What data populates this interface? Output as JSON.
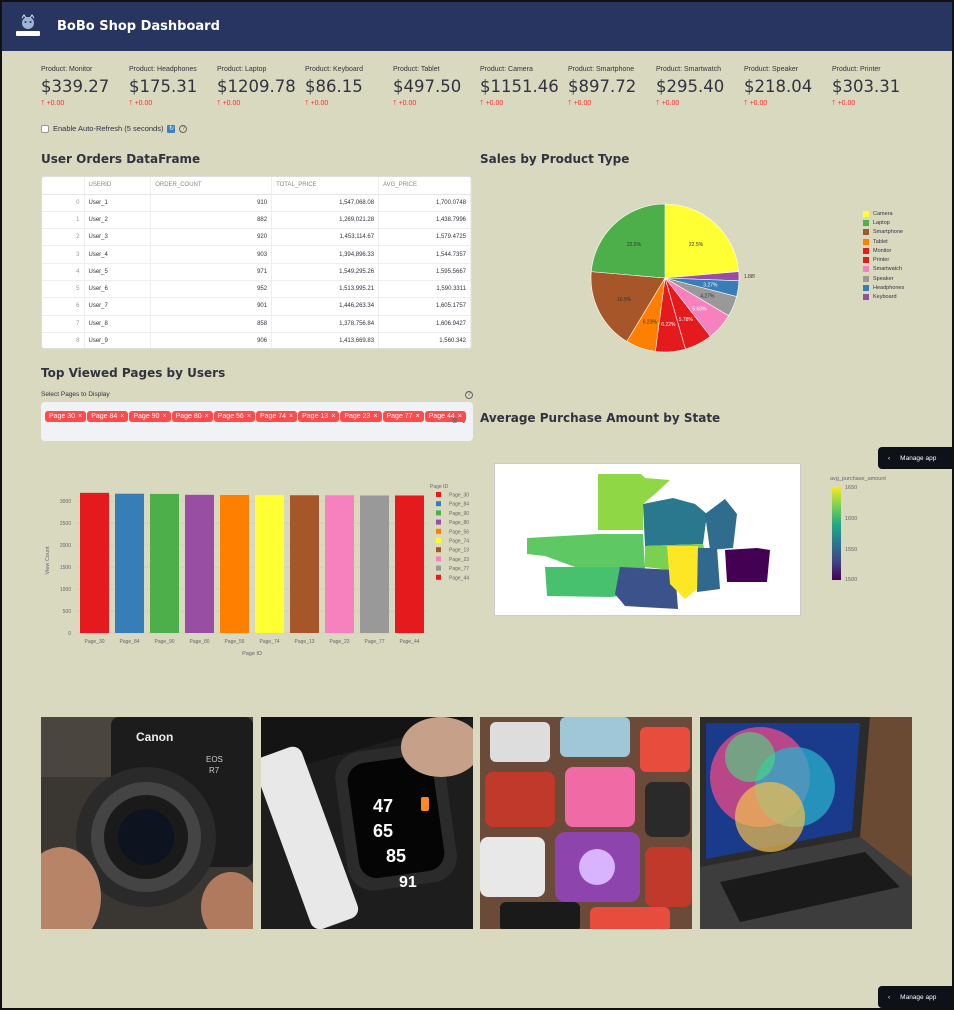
{
  "header": {
    "title": "BoBo Shop Dashboard",
    "logo_text": "BOBO SHOP"
  },
  "metrics": [
    {
      "label": "Product: Monitor",
      "value": "$339.27",
      "delta": "+0.00"
    },
    {
      "label": "Product: Headphones",
      "value": "$175.31",
      "delta": "+0.00"
    },
    {
      "label": "Product: Laptop",
      "value": "$1209.78",
      "delta": "+0.00"
    },
    {
      "label": "Product: Keyboard",
      "value": "$86.15",
      "delta": "+0.00"
    },
    {
      "label": "Product: Tablet",
      "value": "$497.50",
      "delta": "+0.00"
    },
    {
      "label": "Product: Camera",
      "value": "$1151.46",
      "delta": "+0.00"
    },
    {
      "label": "Product: Smartphone",
      "value": "$897.72",
      "delta": "+0.00"
    },
    {
      "label": "Product: Smartwatch",
      "value": "$295.40",
      "delta": "+0.00"
    },
    {
      "label": "Product: Speaker",
      "value": "$218.04",
      "delta": "+0.00"
    },
    {
      "label": "Product: Printer",
      "value": "$303.31",
      "delta": "+0.00"
    }
  ],
  "autorefresh": {
    "label": "Enable Auto-Refresh (5 seconds)",
    "checked": false
  },
  "orders": {
    "title": "User Orders DataFrame",
    "columns": [
      "",
      "USERID",
      "ORDER_COUNT",
      "TOTAL_PRICE",
      "AVG_PRICE"
    ],
    "rows": [
      [
        "0",
        "User_1",
        "910",
        "1,547,068.08",
        "1,700.0748"
      ],
      [
        "1",
        "User_2",
        "882",
        "1,269,021.28",
        "1,438.7996"
      ],
      [
        "2",
        "User_3",
        "920",
        "1,453,114.67",
        "1,579.4725"
      ],
      [
        "3",
        "User_4",
        "903",
        "1,394,896.33",
        "1,544.7357"
      ],
      [
        "4",
        "User_5",
        "971",
        "1,549,295.26",
        "1,595.5667"
      ],
      [
        "5",
        "User_6",
        "952",
        "1,513,995.21",
        "1,590.3311"
      ],
      [
        "6",
        "User_7",
        "901",
        "1,446,263.34",
        "1,605.1757"
      ],
      [
        "7",
        "User_8",
        "858",
        "1,378,756.84",
        "1,606.9427"
      ],
      [
        "8",
        "User_9",
        "906",
        "1,413,669.83",
        "1,560.342"
      ]
    ]
  },
  "pie": {
    "title": "Sales by Product Type",
    "legend": [
      {
        "name": "Camera",
        "color": "#ffff33"
      },
      {
        "name": "Laptop",
        "color": "#4daf4a"
      },
      {
        "name": "Smartphone",
        "color": "#a65628"
      },
      {
        "name": "Tablet",
        "color": "#ff7f00"
      },
      {
        "name": "Monitor",
        "color": "#e41a1c"
      },
      {
        "name": "Printer",
        "color": "#e41a1c"
      },
      {
        "name": "Smartwatch",
        "color": "#f781bf"
      },
      {
        "name": "Speaker",
        "color": "#999999"
      },
      {
        "name": "Headphones",
        "color": "#377eb8"
      },
      {
        "name": "Keyboard",
        "color": "#984ea3"
      }
    ],
    "labels": [
      "22.5%",
      "22.5%",
      "16.9%",
      "6.23%",
      "6.22%",
      "5.78%",
      "5.68%",
      "4.27%",
      "3.27%",
      "1.88%"
    ]
  },
  "pages": {
    "title": "Top Viewed Pages by Users",
    "select_label": "Select Pages to Display",
    "tags": [
      "Page_30",
      "Page_84",
      "Page_90",
      "Page_80",
      "Page_56",
      "Page_74",
      "Page_13",
      "Page_23",
      "Page_77",
      "Page_44"
    ],
    "tag_display": [
      "Page 30",
      "Page 84",
      "Page 90",
      "Page 80",
      "Page 56",
      "Page 74",
      "Page 13",
      "Page 23",
      "Page 77",
      "Page 44"
    ]
  },
  "chart_data": {
    "type": "bar",
    "categories": [
      "Page_30",
      "Page_84",
      "Page_90",
      "Page_80",
      "Page_56",
      "Page_74",
      "Page_13",
      "Page_23",
      "Page_77",
      "Page_44"
    ],
    "values": [
      3190,
      3170,
      3165,
      3145,
      3140,
      3140,
      3135,
      3135,
      3130,
      3130
    ],
    "colors": [
      "#e41a1c",
      "#377eb8",
      "#4daf4a",
      "#984ea3",
      "#ff7f00",
      "#ffff33",
      "#a65628",
      "#f781bf",
      "#999999",
      "#e41a1c"
    ],
    "xlabel": "Page ID",
    "ylabel": "View Count",
    "legend_title": "Page ID",
    "yticks": [
      0,
      500,
      1000,
      1500,
      2000,
      2500,
      3000
    ],
    "ylim": [
      0,
      3300
    ]
  },
  "map": {
    "title": "Average Purchase Amount by State",
    "colorbar_title": "avg_purchase_amount",
    "colorbar_ticks": [
      "1650",
      "1600",
      "1550",
      "1500"
    ]
  },
  "manage_app": "Manage app",
  "photos": [
    "camera-photo",
    "smartwatch-photo",
    "smartphones-photo",
    "laptop-photo"
  ],
  "photo_text": {
    "camera_brand": "Canon",
    "camera_model": "EOS",
    "camera_model2": "R7"
  }
}
